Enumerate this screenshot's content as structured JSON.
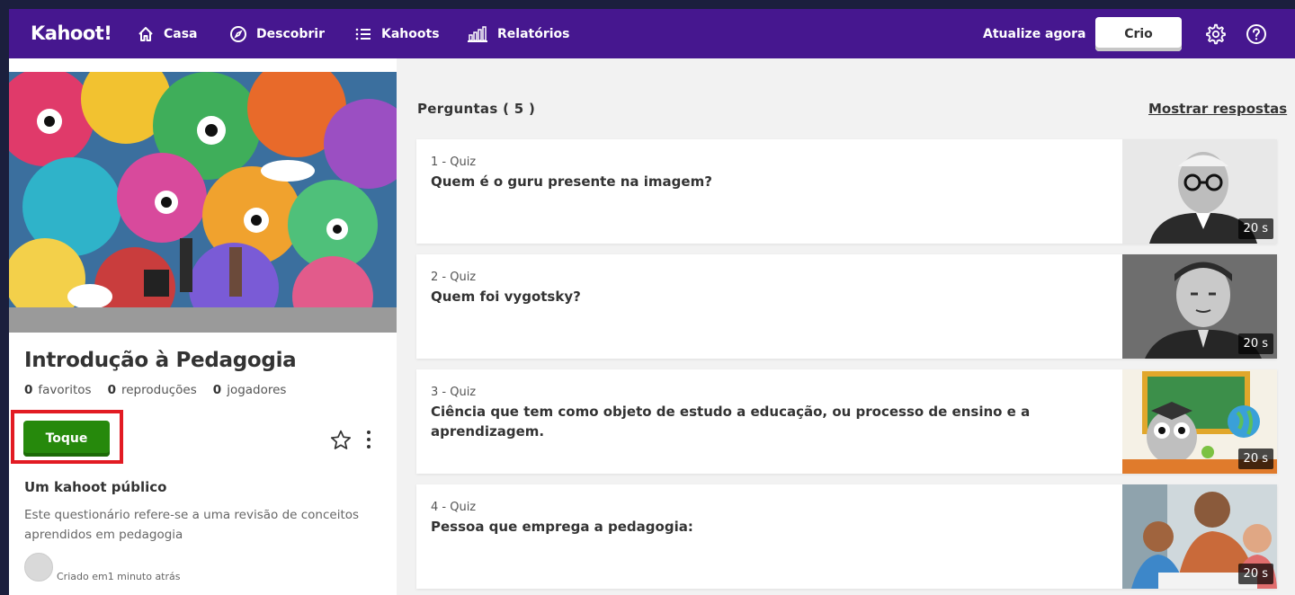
{
  "nav": {
    "logo": "Kahoot!",
    "items": [
      {
        "label": "Casa",
        "icon": "home-icon"
      },
      {
        "label": "Descobrir",
        "icon": "compass-icon"
      },
      {
        "label": "Kahoots",
        "icon": "list-icon"
      },
      {
        "label": "Relatórios",
        "icon": "bar-chart-icon"
      }
    ],
    "upgrade_label": "Atualize agora",
    "create_label": "Crio",
    "settings_icon": "gear-icon",
    "help_icon": "help-icon"
  },
  "kahoot": {
    "title": "Introdução à Pedagogia",
    "stats": [
      {
        "value": "0",
        "label": "favoritos"
      },
      {
        "value": "0",
        "label": "reproduções"
      },
      {
        "value": "0",
        "label": "jogadores"
      }
    ],
    "play_label": "Toque",
    "visibility": "Um kahoot público",
    "description": "Este questionário refere-se a uma revisão de conceitos aprendidos em pedagogia",
    "created": "Criado em1 minuto atrás"
  },
  "questions": {
    "header": "Perguntas  ( 5 )",
    "show_answers": "Mostrar respostas",
    "items": [
      {
        "type": "1 - Quiz",
        "text": "Quem é o guru presente na imagem?",
        "time": "20 s"
      },
      {
        "type": "2 - Quiz",
        "text": "Quem foi vygotsky?",
        "time": "20 s"
      },
      {
        "type": "3 - Quiz",
        "text": "Ciência que tem como objeto de estudo a educação, ou processo de ensino e a aprendizagem.",
        "time": "20 s"
      },
      {
        "type": "4 - Quiz",
        "text": "Pessoa que emprega a pedagogia:",
        "time": "20 s"
      }
    ]
  },
  "colors": {
    "nav_bg": "#46178f",
    "play_button": "#26890c",
    "highlight_outline": "#e21b23"
  }
}
